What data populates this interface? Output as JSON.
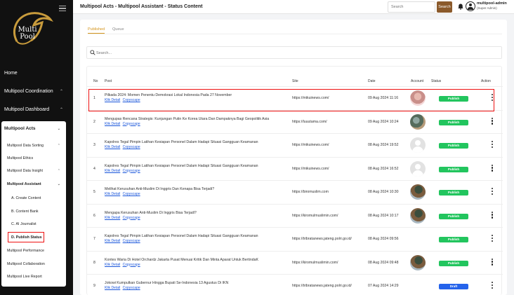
{
  "sidebar": {
    "logo": {
      "line1": "Multi",
      "line2": "Pool"
    },
    "top_items": [
      {
        "label": "Home"
      },
      {
        "label": "Multipool Coordination"
      },
      {
        "label": "Multipool Dashboard"
      }
    ],
    "section": {
      "label": "Multipool Acts",
      "items": [
        {
          "label": "Multipool Data Sorting"
        },
        {
          "label": "Multipool Ethics"
        },
        {
          "label": "Multipool Data Insight"
        },
        {
          "label": "Multipool Assistant"
        },
        {
          "label": "A. Create Content"
        },
        {
          "label": "B. Content Bank"
        },
        {
          "label": "C. AI Journalist"
        },
        {
          "label": "D. Publish Status"
        },
        {
          "label": "Multipool Performance"
        },
        {
          "label": "Multipool Collaboration"
        },
        {
          "label": "Multipool Live Report"
        }
      ]
    }
  },
  "header": {
    "title": "Multipool Acts - Multipool Assistant - Status Content",
    "search_placeholder": "Search",
    "search_button": "Search",
    "user_name": "multipool-admin",
    "user_role": "(Super Admin)"
  },
  "tabs": [
    {
      "label": "Published"
    },
    {
      "label": "Queue"
    }
  ],
  "content_search_placeholder": "Search...",
  "table": {
    "headers": {
      "no": "No",
      "post": "Post",
      "site": "Site",
      "date": "Date",
      "account": "Account",
      "status": "Status",
      "action": "Action"
    },
    "link_labels": {
      "detail": "Klik Detail",
      "copy": "Copyscape"
    },
    "rows": [
      {
        "no": "1",
        "post": "Pilkada 2024: Momen Penentu Demokrasi Lokal Indonesia Pada 27 November",
        "site": "https://mikuinews.com/",
        "date": "09 Aug 2024 11:16",
        "avatar": "pink",
        "status": "Publish"
      },
      {
        "no": "2",
        "post": "Mengupas Rencana Strategis: Kunjungan Putin Ke Korea Utara Dan Dampaknya Bagi Geopolitik Asia",
        "site": "https://luuutama.com/",
        "date": "09 Aug 2024 10:24",
        "avatar": "photo",
        "status": "Publish"
      },
      {
        "no": "3",
        "post": "Kapolres Tegal Pimpin Latihan Kesiapan Personel Dalam Hadapi Situasi Gangguan Keamanan",
        "site": "https://mikuinews.com/",
        "date": "08 Aug 2024 19:52",
        "avatar": "gray",
        "status": "Publish"
      },
      {
        "no": "4",
        "post": "Kapolres Tegal Pimpin Latihan Kesiapan Personel Dalam Hadapi Situasi Gangguan Keamanan",
        "site": "https://mikuinews.com/",
        "date": "08 Aug 2024 16:52",
        "avatar": "gray",
        "status": "Publish"
      },
      {
        "no": "5",
        "post": "Melihat Kerusuhan Anti-Muslim Di Inggris Dan Kenapa Bisa Terjadi?",
        "site": "https://biromuslim.com",
        "date": "08 Aug 2024 10:30",
        "avatar": "photo2",
        "status": "Publish"
      },
      {
        "no": "6",
        "post": "Mengapa Kerusuhan Anti-Muslim Di Inggris Bisa Terjadi?",
        "site": "https://kiromulmuslimin.com/",
        "date": "08 Aug 2024 10:17",
        "avatar": "photo2",
        "status": "Publish"
      },
      {
        "no": "7",
        "post": "Kapolres Tegal Pimpin Latihan Kesiapan Personel Dalam Hadapi Situasi Gangguan Keamanan",
        "site": "https://tribratanews.jateng.polri.go.id/",
        "date": "08 Aug 2024 09:56",
        "avatar": "none",
        "status": "Publish"
      },
      {
        "no": "8",
        "post": "Kontes Waria Di Hotel Orchardz Jakarta Pusat Menuai Kritik Dan Minta Aparat Untuk BertindaK",
        "site": "https://kiromulmuslimin.com/",
        "date": "08 Aug 2024 09:48",
        "avatar": "photo2",
        "status": "Publish"
      },
      {
        "no": "9",
        "post": "Jokowi Kumpulkan Gubernur Hingga Bupati Se-Indonesia 13 Agustus Di IKN",
        "site": "https://tribratanews.jateng.polri.go.id/",
        "date": "07 Aug 2024 14:29",
        "avatar": "none",
        "status": "Draft"
      }
    ]
  }
}
